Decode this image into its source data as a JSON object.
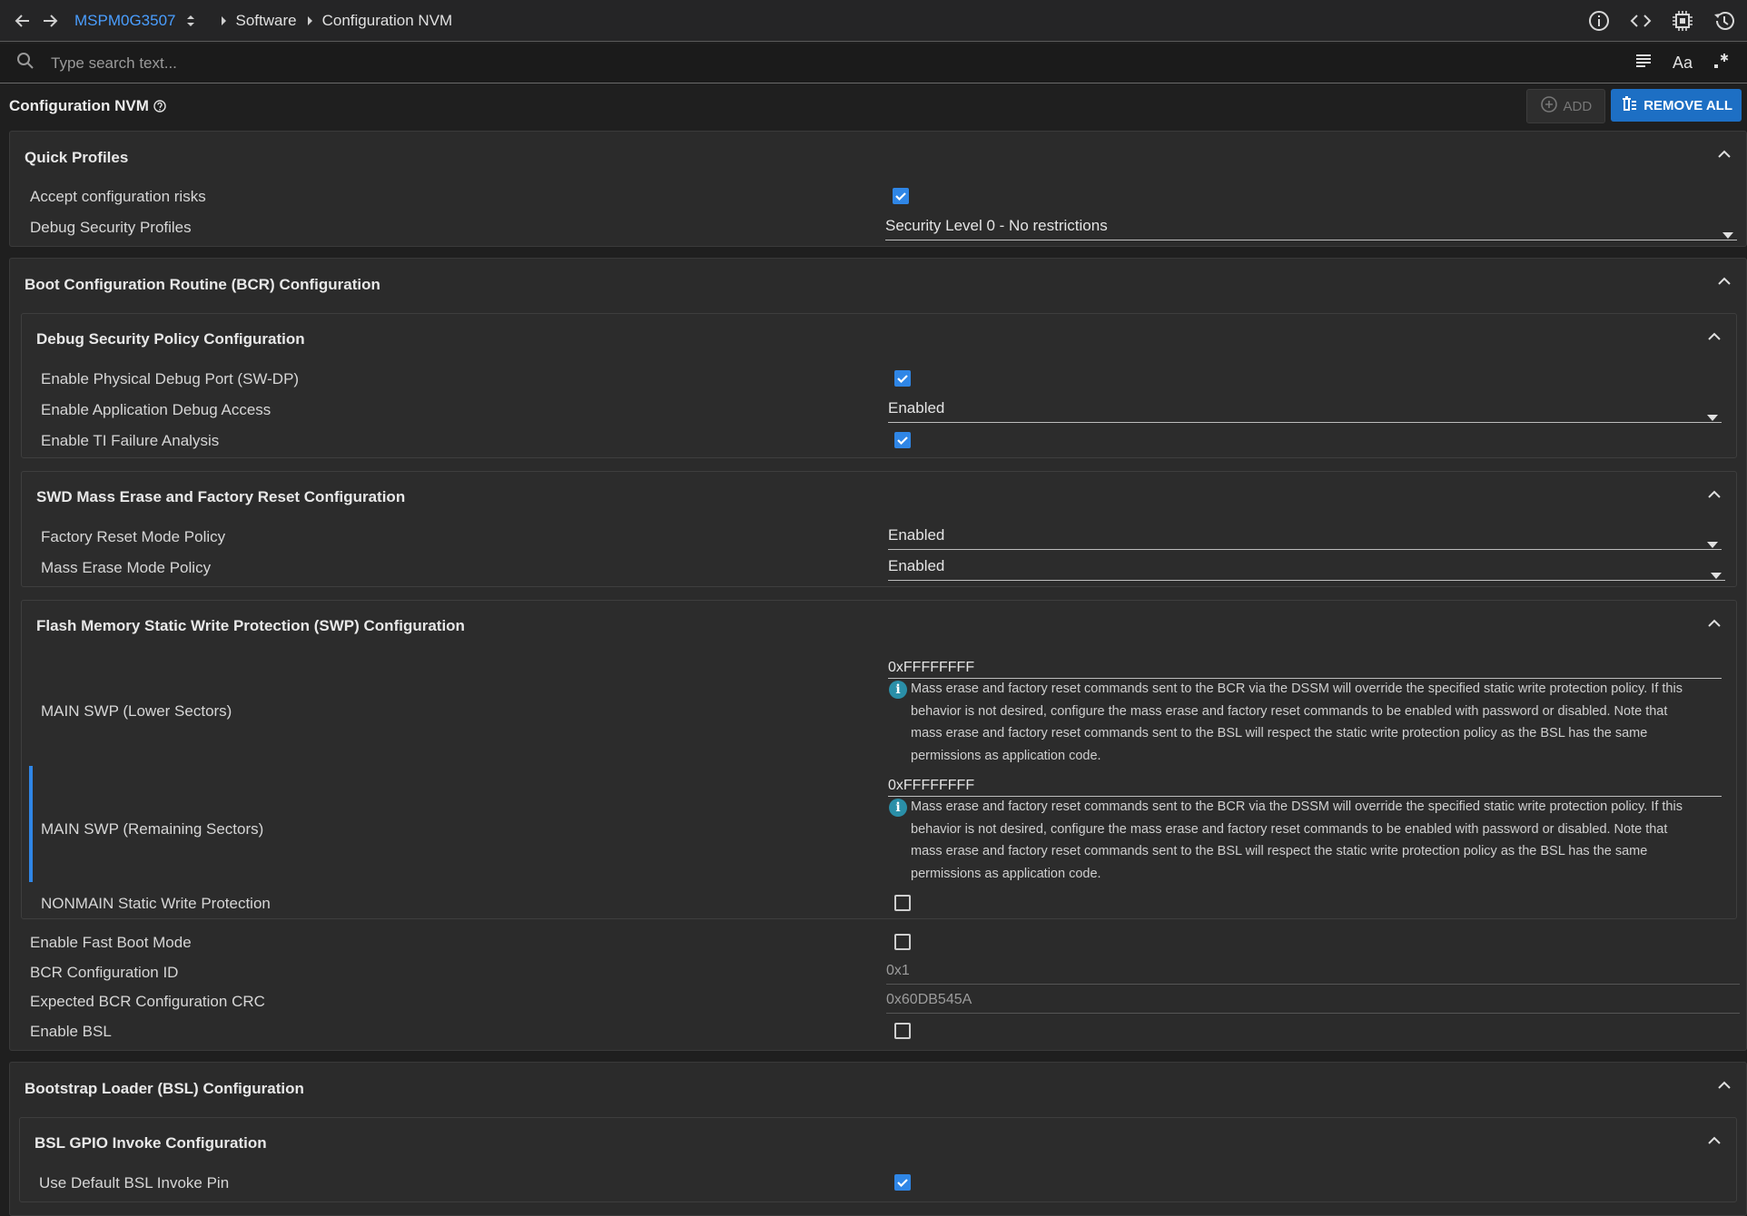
{
  "topbar": {
    "device": "MSPM0G3507",
    "crumbs": [
      "Software",
      "Configuration NVM"
    ],
    "icons": [
      "info-icon",
      "code-icon",
      "chip-icon",
      "history-icon"
    ]
  },
  "search": {
    "placeholder": "Type search text..."
  },
  "page": {
    "title": "Configuration NVM",
    "add_label": "ADD",
    "remove_all_label": "REMOVE ALL"
  },
  "quick_profiles": {
    "title": "Quick Profiles",
    "accept_label": "Accept configuration risks",
    "accept_checked": true,
    "debug_profiles_label": "Debug Security Profiles",
    "debug_profiles_value": "Security Level 0 - No restrictions"
  },
  "bcr": {
    "title": "Boot Configuration Routine (BCR) Configuration",
    "debug_policy": {
      "title": "Debug Security Policy Configuration",
      "swdp_label": "Enable Physical Debug Port (SW-DP)",
      "swdp_checked": true,
      "app_debug_label": "Enable Application Debug Access",
      "app_debug_value": "Enabled",
      "ti_fa_label": "Enable TI Failure Analysis",
      "ti_fa_checked": true
    },
    "swd_mass_erase": {
      "title": "SWD Mass Erase and Factory Reset Configuration",
      "factory_reset_label": "Factory Reset Mode Policy",
      "factory_reset_value": "Enabled",
      "mass_erase_label": "Mass Erase Mode Policy",
      "mass_erase_value": "Enabled"
    },
    "swp": {
      "title": "Flash Memory Static Write Protection (SWP) Configuration",
      "main_lower_label": "MAIN SWP (Lower Sectors)",
      "main_lower_value": "0xFFFFFFFF",
      "main_lower_info": [
        "Mass erase and factory reset commands sent to the BCR via the DSSM will override the specified static write protection policy. If this",
        "behavior is not desired, configure the mass erase and factory reset commands to be enabled with password or disabled. Note that",
        "mass erase and factory reset commands sent to the BSL will respect the static write protection policy as the BSL has the same",
        "permissions as application code."
      ],
      "main_remaining_label": "MAIN SWP (Remaining Sectors)",
      "main_remaining_value": "0xFFFFFFFF",
      "main_remaining_info": [
        "Mass erase and factory reset commands sent to the BCR via the DSSM will override the specified static write protection policy. If this",
        "behavior is not desired, configure the mass erase and factory reset commands to be enabled with password or disabled. Note that",
        "mass erase and factory reset commands sent to the BSL will respect the static write protection policy as the BSL has the same",
        "permissions as application code."
      ],
      "nonmain_label": "NONMAIN Static Write Protection",
      "nonmain_checked": false
    },
    "fast_boot_label": "Enable Fast Boot Mode",
    "fast_boot_checked": false,
    "config_id_label": "BCR Configuration ID",
    "config_id_value": "0x1",
    "crc_label": "Expected BCR Configuration CRC",
    "crc_value": "0x60DB545A",
    "enable_bsl_label": "Enable BSL",
    "enable_bsl_checked": false
  },
  "bsl": {
    "title": "Bootstrap Loader (BSL) Configuration",
    "gpio": {
      "title": "BSL GPIO Invoke Configuration",
      "default_pin_label": "Use Default BSL Invoke Pin",
      "default_pin_checked": true
    }
  },
  "colors": {
    "accent": "#2f86e6",
    "link": "#4a9eff",
    "remove_button": "#1d6fc4",
    "info": "#2a8fa8"
  }
}
